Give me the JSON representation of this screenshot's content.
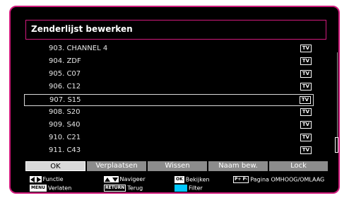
{
  "title": "Zenderlijst bewerken",
  "channels": [
    {
      "name": "903. CHANNEL 4",
      "type": "TV"
    },
    {
      "name": "904. ZDF",
      "type": "TV"
    },
    {
      "name": "905. C07",
      "type": "TV"
    },
    {
      "name": "906. C12",
      "type": "TV"
    },
    {
      "name": "907. S15",
      "type": "TV",
      "selected": true
    },
    {
      "name": "908. S20",
      "type": "TV"
    },
    {
      "name": "909. S40",
      "type": "TV"
    },
    {
      "name": "910. C21",
      "type": "TV"
    },
    {
      "name": "911. C43",
      "type": "TV"
    }
  ],
  "buttons": {
    "ok": "OK",
    "move": "Verplaatsen",
    "delete": "Wissen",
    "rename": "Naam bew.",
    "lock": "Lock"
  },
  "help": {
    "function_label": "Functie",
    "menu_key": "MENU",
    "exit_label": "Verlaten",
    "navigate_label": "Navigeer",
    "return_key": "RETURN",
    "back_label": "Terug",
    "ok_key": "OK",
    "view_label": "Bekijken",
    "filter_label": "Filter",
    "page_keys": "P+ P-",
    "page_label": "Pagina OMHOOG/OMLAAG"
  },
  "colors": {
    "frame": "#d11a7c",
    "filter_key": "#00c8ff"
  }
}
